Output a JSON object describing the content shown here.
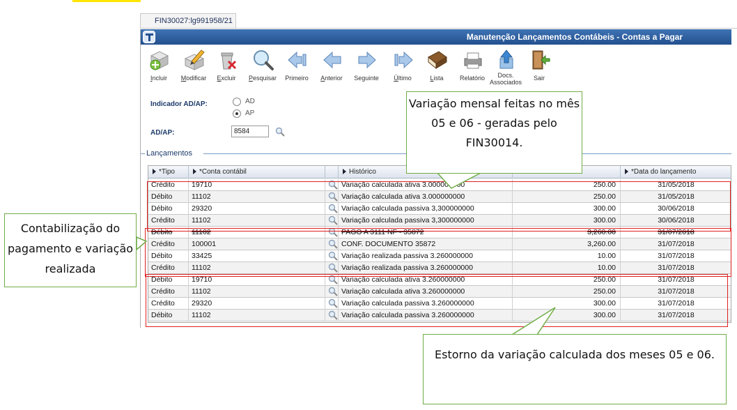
{
  "tab": {
    "label": "FIN30027:lg991958/21"
  },
  "window": {
    "title": "Manutenção Lançamentos Contábeis - Contas a Pagar"
  },
  "toolbar": {
    "buttons": [
      {
        "label_ul": "I",
        "label_rest": "ncluir",
        "icon": "add-icon"
      },
      {
        "label_ul": "M",
        "label_rest": "odificar",
        "icon": "edit-icon"
      },
      {
        "label_ul": "E",
        "label_rest": "xcluir",
        "icon": "delete-icon"
      },
      {
        "label_ul": "P",
        "label_rest": "esquisar",
        "icon": "search-icon"
      },
      {
        "label_ul": "",
        "label_rest": "Primeiro",
        "icon": "first-icon"
      },
      {
        "label_ul": "A",
        "label_rest": "nterior",
        "icon": "previous-icon"
      },
      {
        "label_ul": "",
        "label_rest": "Seguinte",
        "icon": "next-icon"
      },
      {
        "label_ul": "Ú",
        "label_rest": "ltimo",
        "icon": "last-icon"
      },
      {
        "label_ul": "L",
        "label_rest": "ista",
        "icon": "list-icon"
      },
      {
        "label_ul": "",
        "label_rest": "Relatório",
        "icon": "report-icon"
      },
      {
        "label_ul": "",
        "label_rest": "Docs. Associados",
        "icon": "documents-icon"
      },
      {
        "label_ul": "",
        "label_rest": "Sair",
        "icon": "exit-icon"
      }
    ]
  },
  "form": {
    "indicador_label": "Indicador AD/AP:",
    "radio_ad": "AD",
    "radio_ap": "AP",
    "adap_label": "AD/AP:",
    "adap_value": "8584"
  },
  "lancamentos": {
    "section_title": "Lançamentos",
    "columns": [
      "*Tipo",
      "*Conta contábil",
      "",
      "Histórico",
      "",
      "*Data do lançamento"
    ],
    "rows": [
      {
        "tipo": "Crédito",
        "conta": "19710",
        "historico": "Variação calculada ativa 3.000000000",
        "valor": "250.00",
        "data": "31/05/2018"
      },
      {
        "tipo": "Débito",
        "conta": "11102",
        "historico": "Variação calculada ativa 3.000000000",
        "valor": "250.00",
        "data": "31/05/2018"
      },
      {
        "tipo": "Débito",
        "conta": "29320",
        "historico": "Variação calculada passiva 3,300000000",
        "valor": "300.00",
        "data": "30/06/2018"
      },
      {
        "tipo": "Crédito",
        "conta": "11102",
        "historico": "Variação calculada passiva 3,300000000",
        "valor": "300.00",
        "data": "30/06/2018"
      },
      {
        "tipo": "Débito",
        "conta": "11102",
        "historico": "PAGO A 3111 NF - 35872",
        "valor": "3,260.00",
        "data": "31/07/2018"
      },
      {
        "tipo": "Crédito",
        "conta": "100001",
        "historico": "CONF. DOCUMENTO 35872",
        "valor": "3,260.00",
        "data": "31/07/2018"
      },
      {
        "tipo": "Débito",
        "conta": "33425",
        "historico": "Variação realizada passiva 3.260000000",
        "valor": "10.00",
        "data": "31/07/2018"
      },
      {
        "tipo": "Crédito",
        "conta": "11102",
        "historico": "Variação realizada passiva 3.260000000",
        "valor": "10.00",
        "data": "31/07/2018"
      },
      {
        "tipo": "Débito",
        "conta": "19710",
        "historico": "Variação calculada ativa 3.260000000",
        "valor": "250.00",
        "data": "31/07/2018"
      },
      {
        "tipo": "Crédito",
        "conta": "11102",
        "historico": "Variação calculada ativa 3.260000000",
        "valor": "250.00",
        "data": "31/07/2018"
      },
      {
        "tipo": "Crédito",
        "conta": "29320",
        "historico": "Variação calculada passiva 3.260000000",
        "valor": "300.00",
        "data": "31/07/2018"
      },
      {
        "tipo": "Débito",
        "conta": "11102",
        "historico": "Variação calculada passiva 3.260000000",
        "valor": "300.00",
        "data": "31/07/2018"
      }
    ]
  },
  "annotations": {
    "top": "Variação mensal feitas no mês 05 e 06 - geradas pelo FIN30014.",
    "left": "Contabilização do pagamento e variação realizada",
    "bottom": "Estorno da variação calculada dos meses 05 e 06."
  },
  "colors": {
    "title_bar": "#2f5f9f",
    "callout_border": "#70ad47",
    "highlight_box": "#e02020",
    "tab_highlight": "#ffe600"
  }
}
